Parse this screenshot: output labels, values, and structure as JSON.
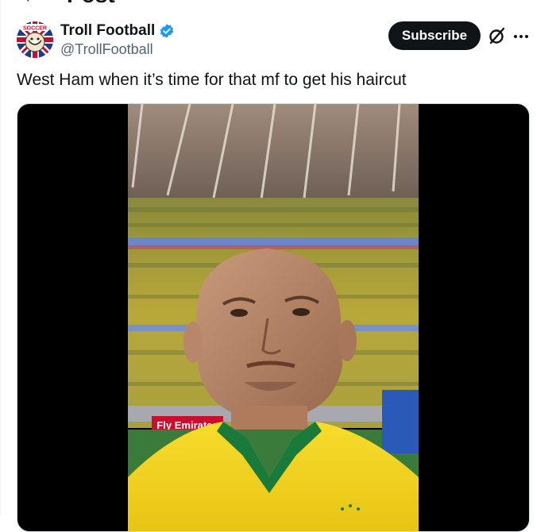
{
  "header": {
    "title": "Post"
  },
  "author": {
    "name": "Troll Football",
    "handle": "@TrollFootball",
    "verified": true,
    "avatar_text": "SOCCER"
  },
  "actions": {
    "subscribe_label": "Subscribe"
  },
  "post": {
    "text": "West Ham when it’s time for that mf to get his haircut"
  },
  "media": {
    "banner_text": "Fly Emirates"
  },
  "colors": {
    "accent": "#1d9bf0",
    "text": "#0f1419",
    "muted": "#536471",
    "jersey": "#f2d21d",
    "collar": "#1a7a3a"
  }
}
